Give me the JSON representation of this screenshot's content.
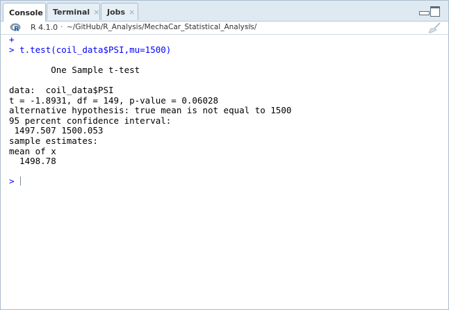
{
  "tabs": [
    {
      "label": "Console",
      "active": true
    },
    {
      "label": "Terminal",
      "active": false,
      "close": "×"
    },
    {
      "label": "Jobs",
      "active": false,
      "close": "×"
    }
  ],
  "toolbar": {
    "r_version": "R 4.1.0",
    "separator": "·",
    "path": "~/GitHub/R_Analysis/MechaCar_Statistical_Analysis/",
    "go_icon": "arrow-go-icon",
    "broom_icon": "broom-icon",
    "r_logo": "r-logo-icon"
  },
  "console": {
    "continuation_prompt": "+",
    "command_prompt": "> ",
    "command": "t.test(coil_data$PSI,mu=1500)",
    "output": {
      "title": "        One Sample t-test",
      "data_line": "data:  coil_data$PSI",
      "stats_line": "t = -1.8931, df = 149, p-value = 0.06028",
      "alt_hypothesis": "alternative hypothesis: true mean is not equal to 1500",
      "ci_label": "95 percent confidence interval:",
      "ci_values": " 1497.507 1500.053",
      "estimates_label": "sample estimates:",
      "mean_label": "mean of x",
      "mean_value": "  1498.78"
    },
    "input_prompt": ">"
  },
  "colors": {
    "prompt_blue": "#0000ff",
    "tabbar_bg": "#dfe9f2",
    "border": "#a9bccd"
  }
}
